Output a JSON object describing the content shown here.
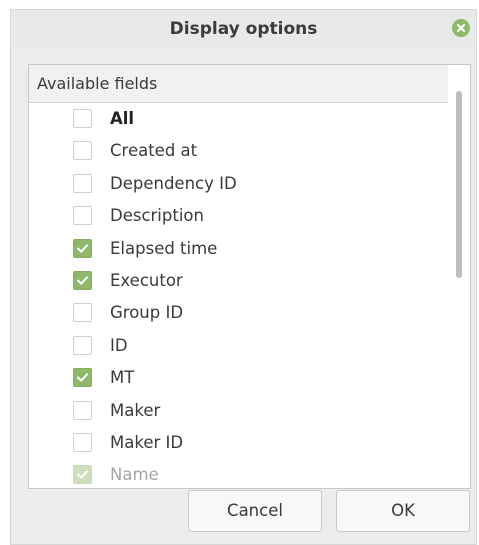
{
  "dialog": {
    "title": "Display options",
    "close_icon": "close-icon",
    "accent_color": "#8fb86a"
  },
  "list": {
    "header": "Available fields",
    "items": [
      {
        "label": "All",
        "checked": false,
        "bold": true
      },
      {
        "label": "Created at",
        "checked": false
      },
      {
        "label": "Dependency ID",
        "checked": false
      },
      {
        "label": "Description",
        "checked": false
      },
      {
        "label": "Elapsed time",
        "checked": true
      },
      {
        "label": "Executor",
        "checked": true
      },
      {
        "label": "Group ID",
        "checked": false
      },
      {
        "label": "ID",
        "checked": false
      },
      {
        "label": "MT",
        "checked": true
      },
      {
        "label": "Maker",
        "checked": false
      },
      {
        "label": "Maker ID",
        "checked": false
      },
      {
        "label": "Name",
        "checked": true
      }
    ]
  },
  "buttons": {
    "cancel": "Cancel",
    "ok": "OK"
  }
}
